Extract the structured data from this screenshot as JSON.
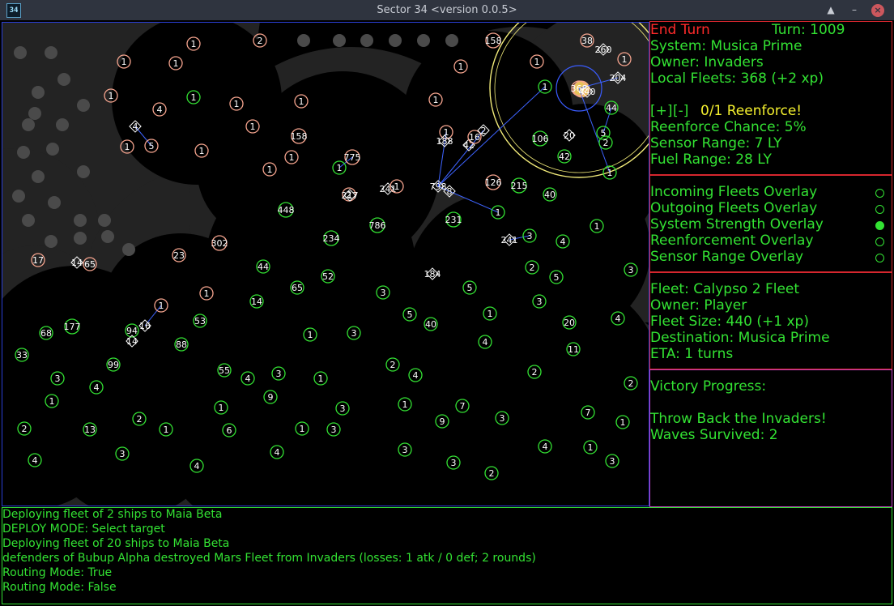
{
  "window": {
    "title": "Sector 34   <version 0.0.5>",
    "icon_label": "34",
    "buttons": {
      "maximize": "▲",
      "minimize": "–",
      "close": "×"
    }
  },
  "colors": {
    "player": "#33e233",
    "invader": "#f7a58f",
    "neutral": "#ffffff",
    "fleet_route": "#3d63ff",
    "selection_ring": "#f3ec7a",
    "sensor_ring": "#3a5cff",
    "highlight": "#ffffff",
    "territory": "#232323"
  },
  "sidebar": {
    "end_turn": "End Turn",
    "turn": "Turn: 1009",
    "system": "System: Musica Prime",
    "owner": "Owner: Invaders",
    "local_fleets": "Local Fleets: 368 (+2 xp)",
    "reinforce_plus": "[+]",
    "reinforce_minus": "[-]",
    "reinforce": "0/1 Reenforce!",
    "reinforce_chance": "Reenforce Chance: 5%",
    "sensor_range": "Sensor Range: 7 LY",
    "fuel_range": "Fuel Range: 28 LY",
    "overlays": [
      {
        "label": "Incoming Fleets Overlay",
        "on": false
      },
      {
        "label": "Outgoing Fleets Overlay",
        "on": false
      },
      {
        "label": "System Strength Overlay",
        "on": true
      },
      {
        "label": "Reenforcement Overlay",
        "on": false
      },
      {
        "label": "Sensor Range Overlay",
        "on": false
      }
    ],
    "fleet": {
      "name": "Fleet: Calypso 2 Fleet",
      "owner": "Owner: Player",
      "size": "Fleet Size: 440 (+1 xp)",
      "destination": "Destination: Musica Prime",
      "eta": "ETA: 1 turns"
    },
    "victory": {
      "title": "Victory Progress:",
      "goal": "Throw Back the Invaders!",
      "waves": "Waves Survived: 2"
    }
  },
  "log": [
    "Deploying fleet of 2 ships to Maia Beta",
    "DEPLOY MODE: Select target",
    "Deploying fleet of 20 ships to Maia Beta",
    "defenders of Bubup Alpha destroyed Mars Fleet from Invaders (losses: 1 atk / 0 def; 2 rounds)",
    "Routing Mode: True",
    "Routing Mode: False"
  ],
  "map": {
    "systems": [
      [
        "1",
        236,
        26,
        "i"
      ],
      [
        "2",
        318,
        22,
        "i"
      ],
      [
        "158",
        606,
        22,
        "i"
      ],
      [
        "1",
        150,
        48,
        "i"
      ],
      [
        "1",
        214,
        50,
        "i"
      ],
      [
        "1",
        566,
        54,
        "i"
      ],
      [
        "1",
        660,
        48,
        "i"
      ],
      [
        "38",
        722,
        22,
        "i"
      ],
      [
        "260",
        742,
        33,
        "w"
      ],
      [
        "1",
        768,
        45,
        "i"
      ],
      [
        "1",
        134,
        90,
        "i"
      ],
      [
        "1",
        236,
        92,
        "g"
      ],
      [
        "1",
        289,
        100,
        "i"
      ],
      [
        "1",
        369,
        97,
        "i"
      ],
      [
        "1",
        535,
        95,
        "i"
      ],
      [
        "1",
        670,
        79,
        "g"
      ],
      [
        "204",
        760,
        68,
        "w"
      ],
      [
        "4",
        194,
        107,
        "i"
      ],
      [
        "1",
        309,
        128,
        "i"
      ],
      [
        "368",
        712,
        81,
        "i"
      ],
      [
        "440",
        722,
        85,
        "w"
      ],
      [
        "44",
        752,
        105,
        "g"
      ],
      [
        "4",
        164,
        128,
        "w"
      ],
      [
        "158",
        366,
        140,
        "i"
      ],
      [
        "1",
        548,
        135,
        "i"
      ],
      [
        "188",
        546,
        146,
        "w"
      ],
      [
        "42",
        576,
        151,
        "w"
      ],
      [
        "16",
        583,
        141,
        "i"
      ],
      [
        "2",
        594,
        133,
        "w"
      ],
      [
        "106",
        664,
        143,
        "g"
      ],
      [
        "20",
        700,
        139,
        "w"
      ],
      [
        "5",
        742,
        136,
        "g"
      ],
      [
        "2",
        745,
        148,
        "g"
      ],
      [
        "1",
        154,
        153,
        "i"
      ],
      [
        "5",
        184,
        152,
        "i"
      ],
      [
        "1",
        246,
        158,
        "i"
      ],
      [
        "1",
        357,
        166,
        "i"
      ],
      [
        "775",
        432,
        166,
        "i"
      ],
      [
        "1",
        330,
        181,
        "i"
      ],
      [
        "1",
        416,
        179,
        "g"
      ],
      [
        "42",
        694,
        165,
        "g"
      ],
      [
        "1",
        750,
        185,
        "g"
      ],
      [
        "2",
        428,
        212,
        "i"
      ],
      [
        "217",
        429,
        213,
        "w"
      ],
      [
        "241",
        476,
        205,
        "w"
      ],
      [
        "1",
        487,
        202,
        "i"
      ],
      [
        "798",
        538,
        202,
        "w"
      ],
      [
        "8",
        552,
        208,
        "w"
      ],
      [
        "126",
        606,
        197,
        "i"
      ],
      [
        "215",
        638,
        201,
        "g"
      ],
      [
        "40",
        676,
        212,
        "g"
      ],
      [
        "448",
        350,
        231,
        "g"
      ],
      [
        "786",
        463,
        250,
        "g"
      ],
      [
        "231",
        557,
        243,
        "g"
      ],
      [
        "1",
        612,
        234,
        "g"
      ],
      [
        "1",
        734,
        251,
        "g"
      ],
      [
        "234",
        406,
        266,
        "g"
      ],
      [
        "302",
        268,
        272,
        "i"
      ],
      [
        "241",
        626,
        268,
        "w"
      ],
      [
        "3",
        651,
        263,
        "g"
      ],
      [
        "4",
        692,
        270,
        "g"
      ],
      [
        "17",
        44,
        293,
        "i"
      ],
      [
        "14",
        92,
        296,
        "w"
      ],
      [
        "65",
        108,
        298,
        "i"
      ],
      [
        "23",
        218,
        287,
        "i"
      ],
      [
        "44",
        322,
        301,
        "g"
      ],
      [
        "2",
        654,
        302,
        "g"
      ],
      [
        "3",
        776,
        305,
        "g"
      ],
      [
        "52",
        402,
        313,
        "g"
      ],
      [
        "184",
        531,
        310,
        "w"
      ],
      [
        "5",
        684,
        314,
        "g"
      ],
      [
        "65",
        364,
        327,
        "g"
      ],
      [
        "5",
        577,
        327,
        "g"
      ],
      [
        "1",
        252,
        334,
        "i"
      ],
      [
        "3",
        470,
        333,
        "g"
      ],
      [
        "14",
        314,
        344,
        "g"
      ],
      [
        "3",
        663,
        344,
        "g"
      ],
      [
        "1",
        196,
        349,
        "i"
      ],
      [
        "53",
        244,
        368,
        "g"
      ],
      [
        "5",
        503,
        360,
        "g"
      ],
      [
        "1",
        602,
        359,
        "g"
      ],
      [
        "4",
        760,
        365,
        "g"
      ],
      [
        "177",
        86,
        375,
        "g"
      ],
      [
        "16",
        176,
        374,
        "w"
      ],
      [
        "94",
        160,
        380,
        "g"
      ],
      [
        "68",
        54,
        383,
        "g"
      ],
      [
        "14",
        160,
        393,
        "w"
      ],
      [
        "1",
        380,
        385,
        "g"
      ],
      [
        "3",
        434,
        383,
        "g"
      ],
      [
        "40",
        529,
        372,
        "g"
      ],
      [
        "20",
        700,
        370,
        "g"
      ],
      [
        "88",
        221,
        397,
        "g"
      ],
      [
        "4",
        596,
        394,
        "g"
      ],
      [
        "33",
        24,
        410,
        "g"
      ],
      [
        "11",
        705,
        403,
        "g"
      ],
      [
        "99",
        137,
        422,
        "g"
      ],
      [
        "2",
        482,
        422,
        "g"
      ],
      [
        "55",
        274,
        429,
        "g"
      ],
      [
        "4",
        303,
        439,
        "g"
      ],
      [
        "3",
        341,
        433,
        "g"
      ],
      [
        "4",
        510,
        435,
        "g"
      ],
      [
        "2",
        657,
        431,
        "g"
      ],
      [
        "3",
        68,
        439,
        "g"
      ],
      [
        "4",
        116,
        450,
        "g"
      ],
      [
        "1",
        393,
        439,
        "g"
      ],
      [
        "2",
        776,
        445,
        "g"
      ],
      [
        "9",
        331,
        462,
        "g"
      ],
      [
        "1",
        61,
        467,
        "g"
      ],
      [
        "1",
        270,
        475,
        "g"
      ],
      [
        "3",
        420,
        476,
        "g"
      ],
      [
        "1",
        497,
        471,
        "g"
      ],
      [
        "7",
        568,
        473,
        "g"
      ],
      [
        "7",
        723,
        481,
        "g"
      ],
      [
        "2",
        169,
        489,
        "g"
      ],
      [
        "9",
        543,
        492,
        "g"
      ],
      [
        "3",
        617,
        488,
        "g"
      ],
      [
        "1",
        766,
        493,
        "g"
      ],
      [
        "2",
        27,
        501,
        "g"
      ],
      [
        "13",
        108,
        502,
        "g"
      ],
      [
        "1",
        202,
        502,
        "g"
      ],
      [
        "6",
        280,
        503,
        "g"
      ],
      [
        "1",
        370,
        501,
        "g"
      ],
      [
        "3",
        409,
        502,
        "g"
      ],
      [
        "3",
        497,
        527,
        "g"
      ],
      [
        "4",
        670,
        523,
        "g"
      ],
      [
        "1",
        726,
        524,
        "g"
      ],
      [
        "3",
        148,
        532,
        "g"
      ],
      [
        "4",
        339,
        530,
        "g"
      ],
      [
        "4",
        40,
        540,
        "g"
      ],
      [
        "4",
        240,
        547,
        "g"
      ],
      [
        "3",
        557,
        543,
        "g"
      ],
      [
        "3",
        753,
        541,
        "g"
      ],
      [
        "2",
        604,
        556,
        "g"
      ]
    ]
  }
}
